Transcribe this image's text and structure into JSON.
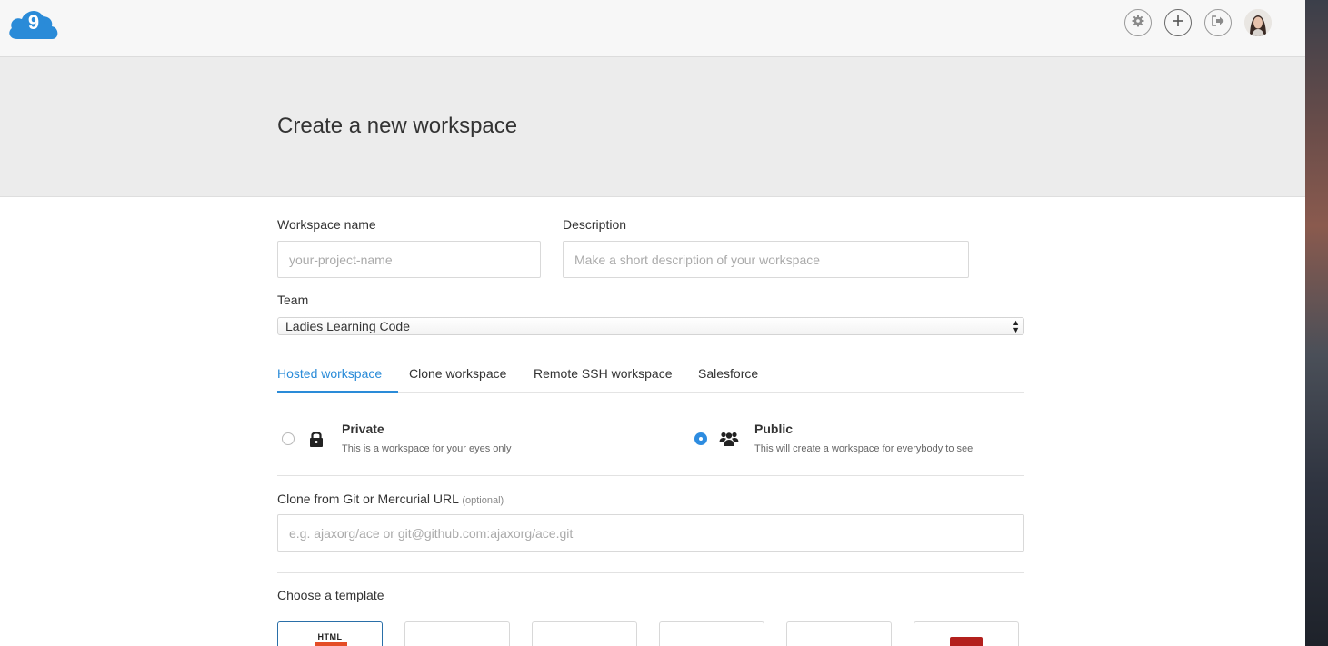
{
  "topbar": {
    "logo_icon": "cloud9-logo",
    "logo_digit": "9",
    "buttons": [
      {
        "icon": "gear-icon"
      },
      {
        "icon": "plus-icon"
      },
      {
        "icon": "sign-out-icon"
      }
    ],
    "avatar_icon": "user-avatar"
  },
  "hero": {
    "title": "Create a new workspace"
  },
  "form": {
    "workspace_name_label": "Workspace name",
    "workspace_name_placeholder": "your-project-name",
    "workspace_name_value": "",
    "description_label": "Description",
    "description_placeholder": "Make a short description of your workspace",
    "description_value": "",
    "team_label": "Team",
    "team_selected": "Ladies Learning Code"
  },
  "tabs": [
    {
      "label": "Hosted workspace",
      "active": true
    },
    {
      "label": "Clone workspace",
      "active": false
    },
    {
      "label": "Remote SSH workspace",
      "active": false
    },
    {
      "label": "Salesforce",
      "active": false
    }
  ],
  "visibility": {
    "private": {
      "title": "Private",
      "description": "This is a workspace for your eyes only",
      "icon": "lock-icon",
      "selected": false
    },
    "public": {
      "title": "Public",
      "description": "This will create a workspace for everybody to see",
      "icon": "users-icon",
      "selected": true
    }
  },
  "clone": {
    "label": "Clone from Git or Mercurial URL",
    "optional": "(optional)",
    "placeholder": "e.g. ajaxorg/ace or git@github.com:ajaxorg/ace.git",
    "value": ""
  },
  "templates": {
    "heading": "Choose a template",
    "items": [
      {
        "badge": "HTML",
        "icon": "html5-icon",
        "selected": true
      },
      {
        "icon": "template-icon",
        "selected": false
      },
      {
        "icon": "template-icon",
        "selected": false
      },
      {
        "icon": "template-icon",
        "selected": false
      },
      {
        "icon": "template-icon",
        "selected": false
      },
      {
        "icon": "template-icon",
        "selected": false
      }
    ]
  },
  "colors": {
    "accent": "#2a8bd8",
    "logo_blue": "#2a8bd8",
    "hero_bg": "#ececec"
  }
}
